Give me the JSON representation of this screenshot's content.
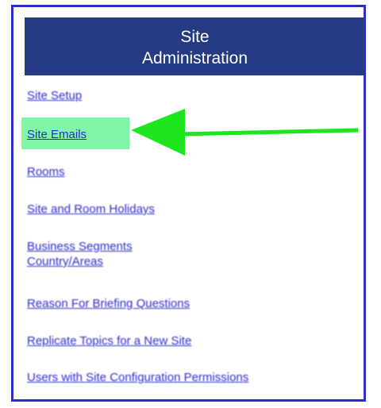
{
  "panel": {
    "title_line1": "Site",
    "title_line2": "Administration"
  },
  "links": [
    {
      "label": "Site Setup"
    },
    {
      "label": "Site Emails"
    },
    {
      "label": "Rooms"
    },
    {
      "label": "Site and Room Holidays"
    },
    {
      "label_line1": "Business Segments",
      "label_line2": "Country/Areas"
    },
    {
      "label": "Reason For Briefing Questions"
    },
    {
      "label": "Replicate Topics for a New Site"
    },
    {
      "label": "Users with Site Configuration Permissions"
    }
  ],
  "colors": {
    "header_bg": "#243a82",
    "link": "#2a2acc",
    "highlight": "#7ff5a6",
    "arrow": "#1ee61e",
    "border": "#2f2fc8"
  },
  "annotation": {
    "type": "arrow-left-icon",
    "color": "#1ee61e"
  }
}
